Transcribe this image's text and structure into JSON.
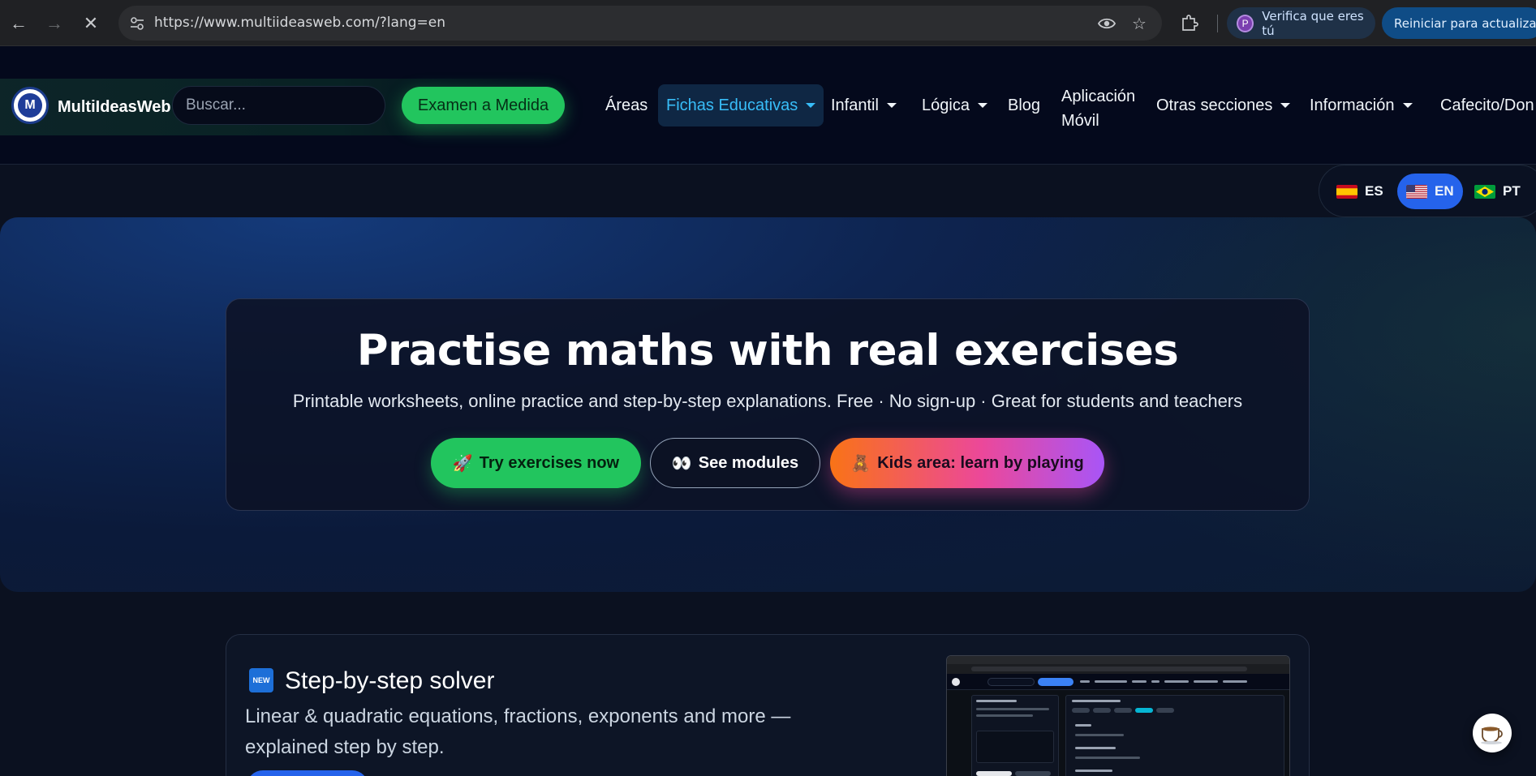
{
  "browser": {
    "url": "https://www.multiideasweb.com/?lang=en",
    "profile_chip": {
      "initial": "P",
      "label": "Verifica que eres tú"
    },
    "update_chip": {
      "label": "Reiniciar para actualizar"
    }
  },
  "header": {
    "brand": "MultiIdeasWeb",
    "logo_letter": "M",
    "search_placeholder": "Buscar...",
    "exam_button": "Examen a Medida",
    "nav": {
      "areas": "Áreas",
      "fichas": "Fichas Educativas",
      "infantil": "Infantil",
      "logica": "Lógica",
      "blog": "Blog",
      "app_line1": "Aplicación",
      "app_line2": "Móvil",
      "otras": "Otras secciones",
      "informacion": "Información",
      "cafecito": "Cafecito/Don"
    },
    "active_nav": "Fichas Educativas",
    "accent_color": "#22c55e"
  },
  "languages": {
    "items": [
      {
        "code": "ES",
        "flag": "spain-flag-icon"
      },
      {
        "code": "EN",
        "flag": "usa-flag-icon"
      },
      {
        "code": "PT",
        "flag": "brazil-flag-icon"
      }
    ],
    "selected": "EN"
  },
  "hero": {
    "title": "Practise maths with real exercises",
    "subtitle": "Printable worksheets, online practice and step-by-step explanations. Free · No sign-up · Great for students and teachers",
    "buttons": {
      "try": {
        "emoji": "🚀",
        "label": "Try exercises now"
      },
      "modules": {
        "emoji": "👀",
        "label": "See modules"
      },
      "kids": {
        "emoji": "🧸",
        "label": "Kids area: learn by playing"
      }
    }
  },
  "solver": {
    "badge": "NEW",
    "title": "Step-by-step solver",
    "description": "Linear & quadratic equations, fractions, exponents and more — explained step by step."
  },
  "floating": {
    "icon": "coffee-cup-icon"
  }
}
